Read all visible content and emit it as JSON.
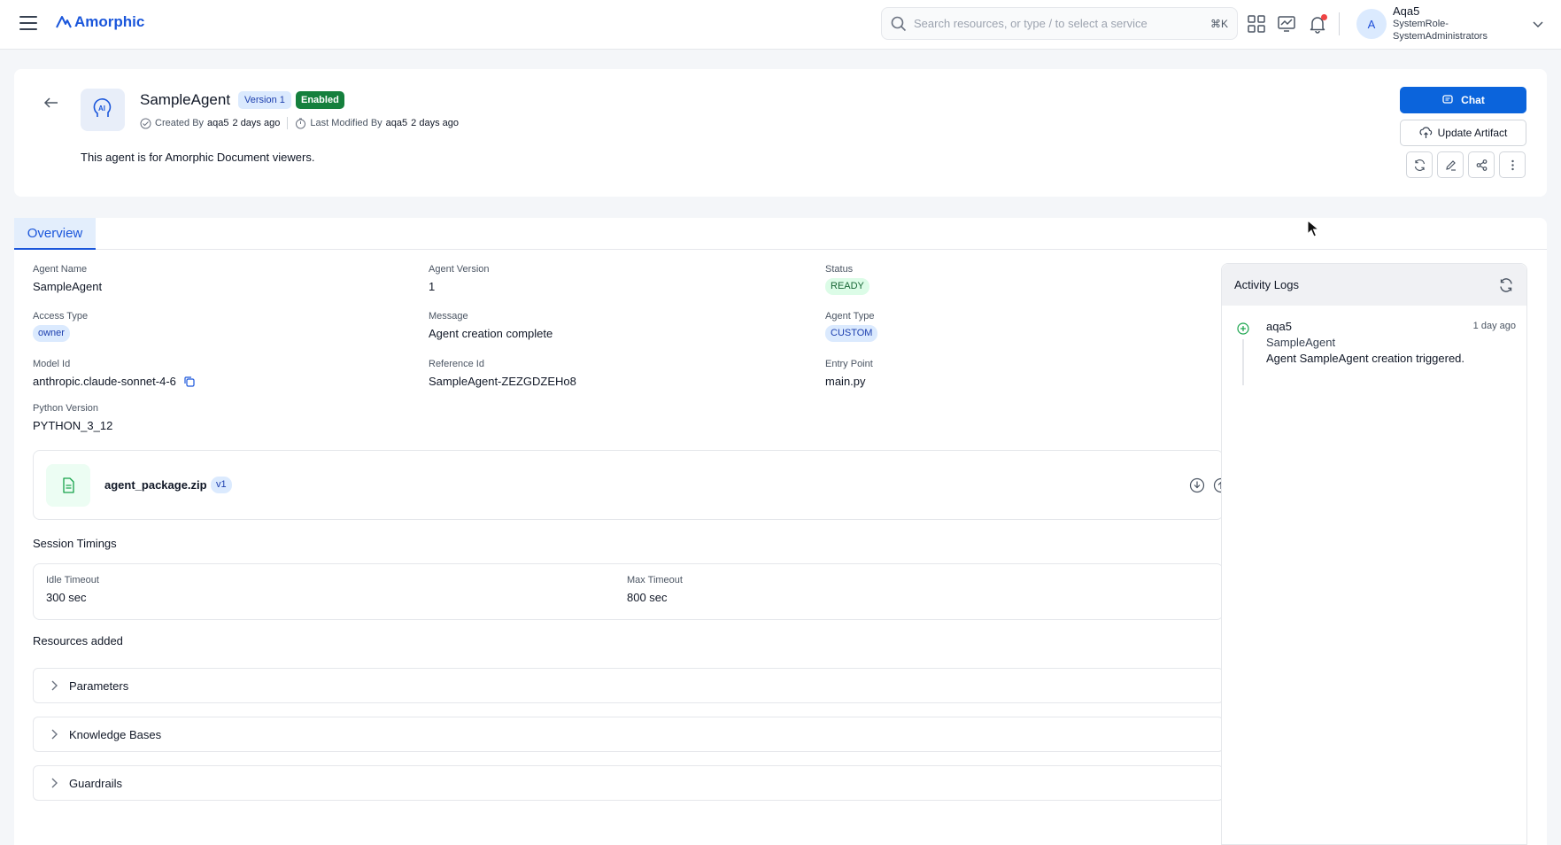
{
  "topbar": {
    "logo_text": "Amorphic",
    "search_placeholder": "Search resources, or type / to select a service",
    "search_shortcut": "⌘K",
    "user": {
      "avatar_initial": "A",
      "name": "Aqa5",
      "role_line1": "SystemRole-",
      "role_line2": "SystemAdministrators"
    }
  },
  "header": {
    "agent_name": "SampleAgent",
    "version_badge": "Version 1",
    "enabled_badge": "Enabled",
    "created_by_label": "Created By",
    "created_by_user": "aqa5",
    "created_when": "2 days ago",
    "modified_by_label": "Last Modified By",
    "modified_by_user": "aqa5",
    "modified_when": "2 days ago",
    "description": "This agent is for Amorphic Document viewers.",
    "chat_label": "Chat",
    "update_artifact_label": "Update Artifact"
  },
  "tabs": [
    {
      "label": "Overview"
    }
  ],
  "details": {
    "agent_name": {
      "label": "Agent Name",
      "value": "SampleAgent"
    },
    "agent_version": {
      "label": "Agent Version",
      "value": "1"
    },
    "status": {
      "label": "Status",
      "value": "READY"
    },
    "access_type": {
      "label": "Access Type",
      "value": "owner"
    },
    "message": {
      "label": "Message",
      "value": "Agent creation complete"
    },
    "agent_type": {
      "label": "Agent Type",
      "value": "CUSTOM"
    },
    "model_id": {
      "label": "Model Id",
      "value": "anthropic.claude-sonnet-4-6"
    },
    "reference_id": {
      "label": "Reference Id",
      "value": "SampleAgent-ZEZGDZEHo8"
    },
    "entry_point": {
      "label": "Entry Point",
      "value": "main.py"
    },
    "python_version": {
      "label": "Python Version",
      "value": "PYTHON_3_12"
    }
  },
  "artifact": {
    "file_name": "agent_package.zip",
    "version": "v1"
  },
  "session_timings": {
    "title": "Session Timings",
    "idle_timeout": {
      "label": "Idle Timeout",
      "value": "300 sec"
    },
    "max_timeout": {
      "label": "Max Timeout",
      "value": "800 sec"
    }
  },
  "resources": {
    "title": "Resources added",
    "items": [
      {
        "label": "Parameters"
      },
      {
        "label": "Knowledge Bases"
      },
      {
        "label": "Guardrails"
      }
    ]
  },
  "activity_logs": {
    "title": "Activity Logs",
    "entries": [
      {
        "user": "aqa5",
        "time": "1 day ago",
        "object": "SampleAgent",
        "message": "Agent SampleAgent creation triggered."
      }
    ]
  },
  "colors": {
    "primary": "#0b64dc",
    "enabled_badge": "#15803d",
    "status_ready_bg": "#dcfce7",
    "chip_blue_bg": "#dbeafe"
  }
}
